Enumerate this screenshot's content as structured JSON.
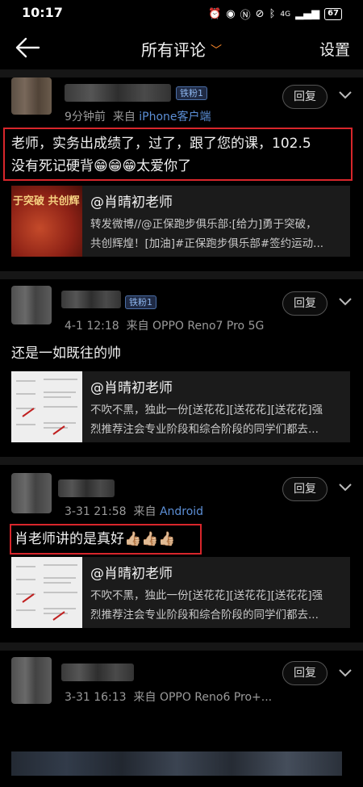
{
  "status_bar": {
    "time": "10:17",
    "battery": "67",
    "network": "4G"
  },
  "header": {
    "title": "所有评论",
    "settings_label": "设置",
    "accent": "#ff8a2a"
  },
  "comments": [
    {
      "badge": "铁粉1",
      "time": "9分钟前",
      "from": "来自",
      "source": "iPhone客户端",
      "reply_label": "回复",
      "text_lines": [
        "老师，实务出成绩了，过了，跟了您的课，102.5",
        "没有死记硬背😁😁😁太爱你了"
      ],
      "card": {
        "title": "@肖晴初老师",
        "desc_lines": [
          "转发微博//@正保跑步俱乐部:[给力]勇于突破，",
          "共创辉煌！[加油]#正保跑步俱乐部#签约运动..."
        ],
        "thumb_text": "于突破 共创辉"
      }
    },
    {
      "badge": "铁粉1",
      "time": "4-1 12:18",
      "from": "来自",
      "source": "OPPO Reno7 Pro 5G",
      "reply_label": "回复",
      "text_lines": [
        "还是一如既往的帅"
      ],
      "card": {
        "title": "@肖晴初老师",
        "desc_lines": [
          "不吹不黑，独此一份[送花花][送花花][送花花]强",
          "烈推荐注会专业阶段和综合阶段的同学们都去..."
        ]
      }
    },
    {
      "time": "3-31 21:58",
      "from": "来自",
      "source": "Android",
      "reply_label": "回复",
      "text_lines": [
        "肖老师讲的是真好👍🏼👍🏼👍🏼"
      ],
      "card": {
        "title": "@肖晴初老师",
        "desc_lines": [
          "不吹不黑，独此一份[送花花][送花花][送花花]强",
          "烈推荐注会专业阶段和综合阶段的同学们都去..."
        ]
      }
    },
    {
      "time": "3-31 16:13",
      "from": "来自",
      "source": "OPPO Reno6 Pro+...",
      "reply_label": "回复"
    }
  ],
  "colors": {
    "highlight_box": "#d8262b",
    "source_link": "#5c8fd6",
    "background": "#000000"
  }
}
